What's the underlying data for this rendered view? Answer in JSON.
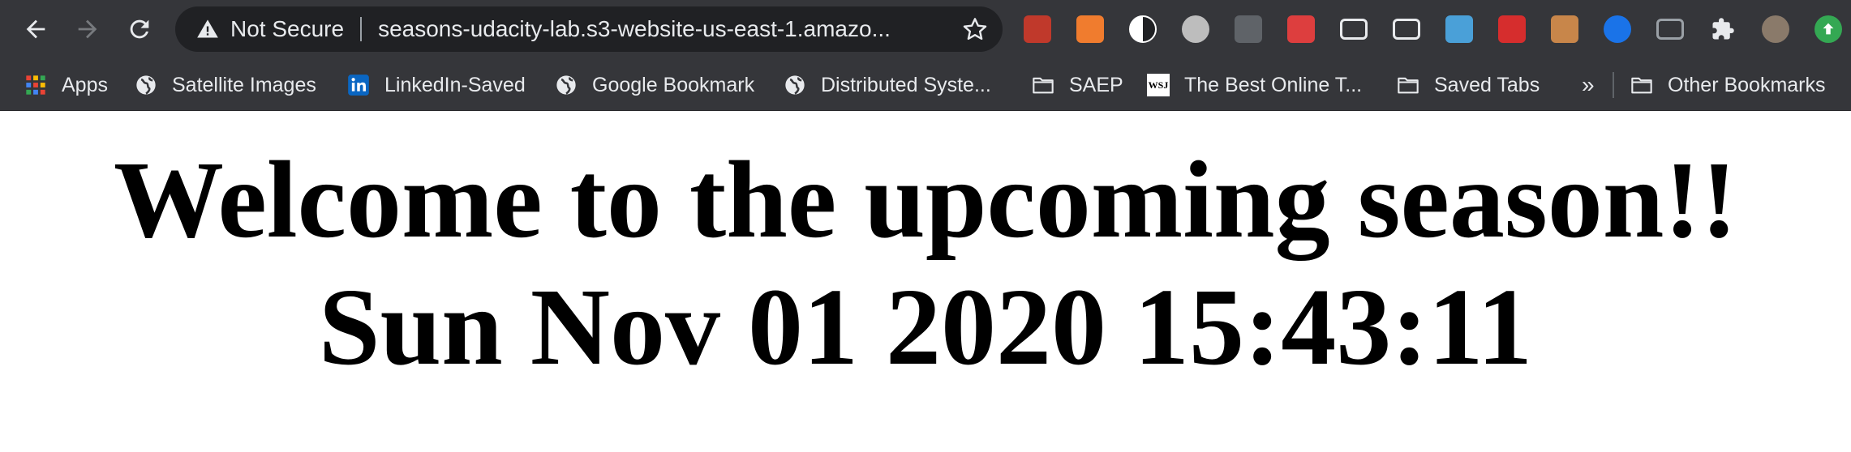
{
  "browser": {
    "security_label": "Not Secure",
    "url": "seasons-udacity-lab.s3-website-us-east-1.amazo...",
    "icons": {
      "back": "back-arrow-icon",
      "forward": "forward-arrow-icon",
      "reload": "reload-icon",
      "warning": "warning-icon",
      "star": "bookmark-star-icon"
    },
    "extensions": [
      {
        "name": "pdf-extension-icon",
        "color": "#c0392b"
      },
      {
        "name": "analytics-extension-icon",
        "color": "#f07c2e"
      },
      {
        "name": "dark-mode-extension-icon",
        "color": "#ffffff"
      },
      {
        "name": "circle-extension-icon",
        "color": "#bdbdbd"
      },
      {
        "name": "django-extension-icon",
        "color": "#5f6368"
      },
      {
        "name": "angular-extension-icon",
        "color": "#dd3e3e"
      },
      {
        "name": "card-extension-icon",
        "color": "#e8eaed"
      },
      {
        "name": "ticket-extension-icon",
        "color": "#e8eaed"
      },
      {
        "name": "app-extension-icon",
        "color": "#4aa0d8"
      },
      {
        "name": "shield-extension-icon",
        "color": "#d62d2d"
      },
      {
        "name": "cookie-extension-icon",
        "color": "#c8864a"
      },
      {
        "name": "google-extension-icon",
        "color": "#1a73e8"
      },
      {
        "name": "window-extension-icon",
        "color": "#9aa0a6"
      },
      {
        "name": "puzzle-extension-icon",
        "color": "#e8eaed"
      },
      {
        "name": "profile-avatar-icon",
        "color": "#8a7a6a"
      },
      {
        "name": "update-arrow-icon",
        "color": "#34a853"
      }
    ]
  },
  "bookmarks": [
    {
      "label": "Apps",
      "icon": "apps-grid-icon"
    },
    {
      "label": "Satellite Images",
      "icon": "globe-icon"
    },
    {
      "label": "LinkedIn-Saved",
      "icon": "linkedin-icon"
    },
    {
      "label": "Google Bookmark",
      "icon": "globe-icon"
    },
    {
      "label": "Distributed Syste...",
      "icon": "globe-icon"
    },
    {
      "label": "SAEP",
      "icon": "folder-icon"
    },
    {
      "label": "The Best Online T...",
      "icon": "wsj-icon"
    },
    {
      "label": "Saved Tabs",
      "icon": "folder-icon"
    },
    {
      "label": "Other Bookmarks",
      "icon": "folder-icon"
    }
  ],
  "bookmarks_overflow": "»",
  "wsj_text": "WSJ",
  "page": {
    "welcome": "Welcome to the upcoming season!!",
    "datetime": "Sun Nov 01 2020 15:43:11"
  }
}
